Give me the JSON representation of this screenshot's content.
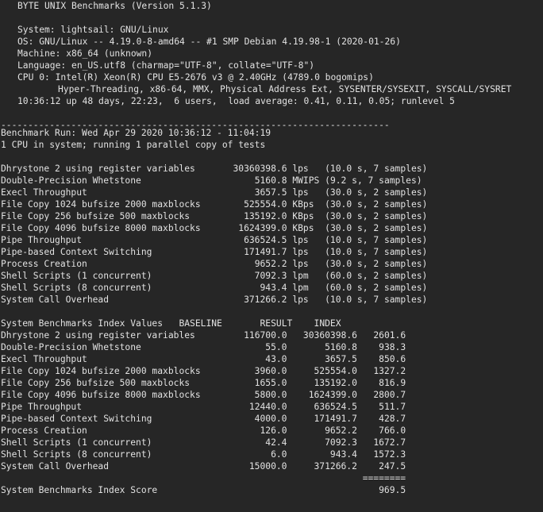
{
  "header": {
    "title": "BYTE UNIX Benchmarks (Version 5.1.3)",
    "system": "System: lightsail: GNU/Linux",
    "os": "OS: GNU/Linux -- 4.19.0-8-amd64 -- #1 SMP Debian 4.19.98-1 (2020-01-26)",
    "machine": "Machine: x86_64 (unknown)",
    "language": "Language: en_US.utf8 (charmap=\"UTF-8\", collate=\"UTF-8\")",
    "cpu": "CPU 0: Intel(R) Xeon(R) CPU E5-2676 v3 @ 2.40GHz (4789.0 bogomips)",
    "cpu_flags": "Hyper-Threading, x86-64, MMX, Physical Address Ext, SYSENTER/SYSEXIT, SYSCALL/SYSRET",
    "uptime": "10:36:12 up 48 days, 22:23,  6 users,  load average: 0.41, 0.11, 0.05; runlevel 5"
  },
  "separator": "------------------------------------------------------------------------",
  "run": {
    "benchmark_run": "Benchmark Run: Wed Apr 29 2020 10:36:12 - 11:04:19",
    "cpus": "1 CPU in system; running 1 parallel copy of tests"
  },
  "results": [
    {
      "name": "Dhrystone 2 using register variables",
      "value": "30360398.6",
      "unit": "lps",
      "detail": "(10.0 s, 7 samples)"
    },
    {
      "name": "Double-Precision Whetstone",
      "value": "5160.8",
      "unit": "MWIPS",
      "detail": "(9.2 s, 7 samples)"
    },
    {
      "name": "Execl Throughput",
      "value": "3657.5",
      "unit": "lps",
      "detail": "(30.0 s, 2 samples)"
    },
    {
      "name": "File Copy 1024 bufsize 2000 maxblocks",
      "value": "525554.0",
      "unit": "KBps",
      "detail": "(30.0 s, 2 samples)"
    },
    {
      "name": "File Copy 256 bufsize 500 maxblocks",
      "value": "135192.0",
      "unit": "KBps",
      "detail": "(30.0 s, 2 samples)"
    },
    {
      "name": "File Copy 4096 bufsize 8000 maxblocks",
      "value": "1624399.0",
      "unit": "KBps",
      "detail": "(30.0 s, 2 samples)"
    },
    {
      "name": "Pipe Throughput",
      "value": "636524.5",
      "unit": "lps",
      "detail": "(10.0 s, 7 samples)"
    },
    {
      "name": "Pipe-based Context Switching",
      "value": "171491.7",
      "unit": "lps",
      "detail": "(10.0 s, 7 samples)"
    },
    {
      "name": "Process Creation",
      "value": "9652.2",
      "unit": "lps",
      "detail": "(30.0 s, 2 samples)"
    },
    {
      "name": "Shell Scripts (1 concurrent)",
      "value": "7092.3",
      "unit": "lpm",
      "detail": "(60.0 s, 2 samples)"
    },
    {
      "name": "Shell Scripts (8 concurrent)",
      "value": "943.4",
      "unit": "lpm",
      "detail": "(60.0 s, 2 samples)"
    },
    {
      "name": "System Call Overhead",
      "value": "371266.2",
      "unit": "lps",
      "detail": "(10.0 s, 7 samples)"
    }
  ],
  "index_table": {
    "title": "System Benchmarks Index Values",
    "col_baseline": "BASELINE",
    "col_result": "RESULT",
    "col_index": "INDEX",
    "rows": [
      {
        "name": "Dhrystone 2 using register variables",
        "baseline": "116700.0",
        "result": "30360398.6",
        "index": "2601.6"
      },
      {
        "name": "Double-Precision Whetstone",
        "baseline": "55.0",
        "result": "5160.8",
        "index": "938.3"
      },
      {
        "name": "Execl Throughput",
        "baseline": "43.0",
        "result": "3657.5",
        "index": "850.6"
      },
      {
        "name": "File Copy 1024 bufsize 2000 maxblocks",
        "baseline": "3960.0",
        "result": "525554.0",
        "index": "1327.2"
      },
      {
        "name": "File Copy 256 bufsize 500 maxblocks",
        "baseline": "1655.0",
        "result": "135192.0",
        "index": "816.9"
      },
      {
        "name": "File Copy 4096 bufsize 8000 maxblocks",
        "baseline": "5800.0",
        "result": "1624399.0",
        "index": "2800.7"
      },
      {
        "name": "Pipe Throughput",
        "baseline": "12440.0",
        "result": "636524.5",
        "index": "511.7"
      },
      {
        "name": "Pipe-based Context Switching",
        "baseline": "4000.0",
        "result": "171491.7",
        "index": "428.7"
      },
      {
        "name": "Process Creation",
        "baseline": "126.0",
        "result": "9652.2",
        "index": "766.0"
      },
      {
        "name": "Shell Scripts (1 concurrent)",
        "baseline": "42.4",
        "result": "7092.3",
        "index": "1672.7"
      },
      {
        "name": "Shell Scripts (8 concurrent)",
        "baseline": "6.0",
        "result": "943.4",
        "index": "1572.3"
      },
      {
        "name": "System Call Overhead",
        "baseline": "15000.0",
        "result": "371266.2",
        "index": "247.5"
      }
    ],
    "rule": "========",
    "score_label": "System Benchmarks Index Score",
    "score_value": "969.5"
  }
}
